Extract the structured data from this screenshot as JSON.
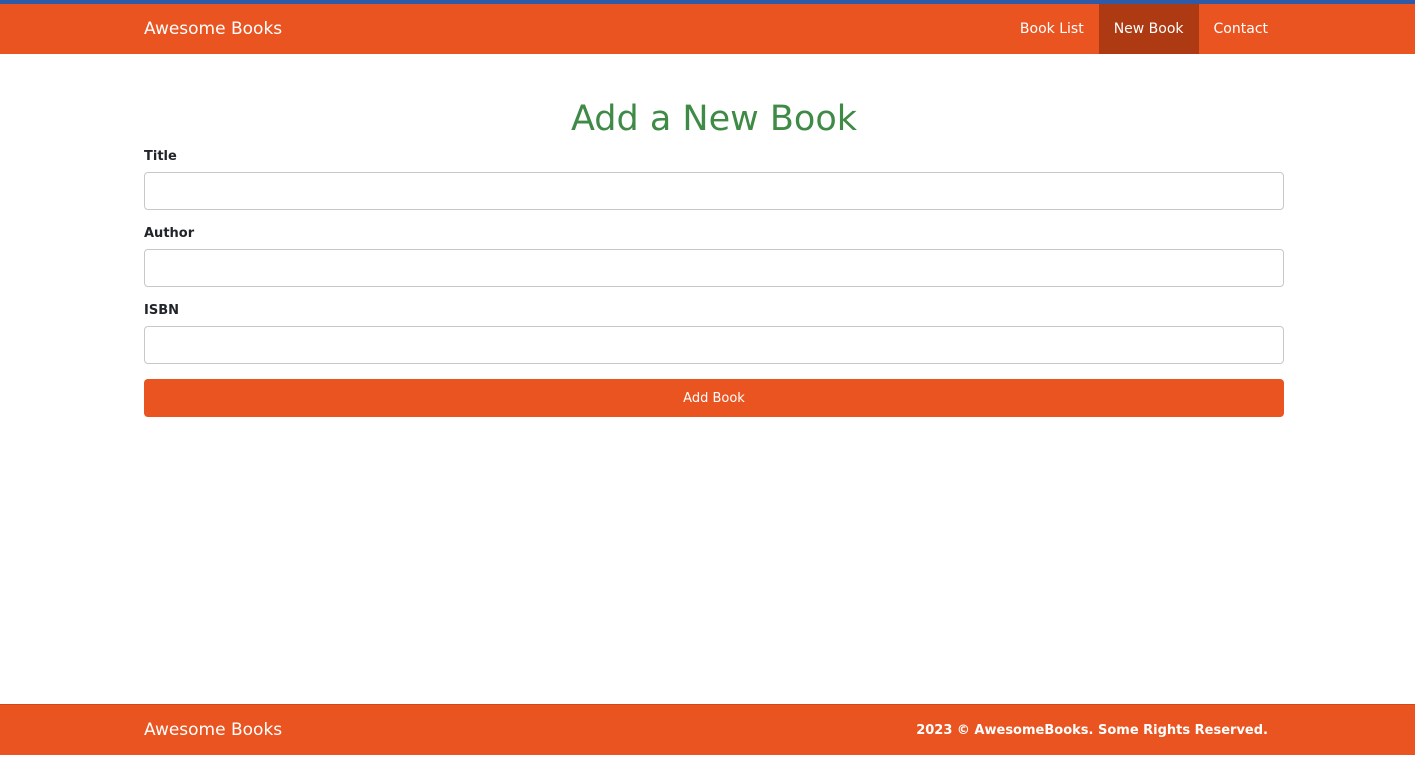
{
  "navbar": {
    "brand": "Awesome Books",
    "links": [
      {
        "label": "Book List",
        "active": false
      },
      {
        "label": "New Book",
        "active": true
      },
      {
        "label": "Contact",
        "active": false
      }
    ]
  },
  "form": {
    "title": "Add a New Book",
    "fields": [
      {
        "label": "Title",
        "value": "",
        "placeholder": ""
      },
      {
        "label": "Author",
        "value": "",
        "placeholder": ""
      },
      {
        "label": "ISBN",
        "value": "",
        "placeholder": ""
      }
    ],
    "submit_label": "Add Book"
  },
  "footer": {
    "brand": "Awesome Books",
    "copyright": "2023 © AwesomeBooks. Some Rights Reserved."
  },
  "colors": {
    "primary": "#e95420",
    "nav_active": "#ad3a13",
    "title": "#3f8a47",
    "top_accent": "#2f5aa8"
  }
}
